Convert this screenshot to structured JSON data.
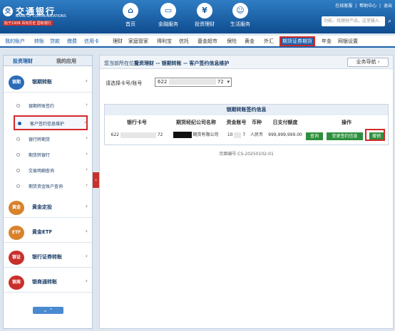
{
  "header": {
    "logo_glyph": "交",
    "bank_name_cn": "交通银行",
    "bank_name_en": "BANK OF COMMUNICATIONS",
    "since": "始于1908 百年历史 国有银行",
    "nav": [
      {
        "label": "首页",
        "icon": "home-icon",
        "glyph": "⌂"
      },
      {
        "label": "金融服务",
        "icon": "card-icon",
        "glyph": "▭"
      },
      {
        "label": "投资理财",
        "icon": "chart-icon",
        "glyph": "¥"
      },
      {
        "label": "生活服务",
        "icon": "life-icon",
        "glyph": "☺"
      }
    ],
    "top_links": [
      "在线客服",
      "|",
      "帮助中心",
      "|",
      "退出"
    ],
    "search_placeholder": "功能、找理财产品，这里输入",
    "search_glyph": "⌕"
  },
  "menubar": {
    "items": [
      "我的账户",
      "转账",
      "贷款",
      "缴费",
      "信用卡",
      "理财",
      "家庭管家",
      "得利宝",
      "信托",
      "基金超市",
      "保险",
      "黄金",
      "外汇",
      "期货证券期货",
      "年金",
      "网银设置"
    ]
  },
  "sidebar": {
    "tabs": [
      "投资理财",
      "我的应用"
    ],
    "sections": [
      {
        "icon_label": "银期",
        "label": "银期转账",
        "arrow": "›"
      },
      {
        "icon_label": "黄金",
        "label": "黄金定投",
        "arrow": "›"
      },
      {
        "icon_label": "ETF",
        "label": "黄金ETF",
        "arrow": "›"
      },
      {
        "icon_label": "银证",
        "label": "银行证券转账",
        "arrow": "›"
      },
      {
        "icon_label": "银商",
        "label": "银商通转账",
        "arrow": "›"
      }
    ],
    "subitems": [
      {
        "label": "银期转账签约",
        "arrow": "›"
      },
      {
        "label": "客户签约信息维护",
        "arrow": "›"
      },
      {
        "label": "银行转期货",
        "arrow": "›"
      },
      {
        "label": "期货转银行",
        "arrow": "›"
      },
      {
        "label": "交易明细查询",
        "arrow": "›"
      },
      {
        "label": "期货资金账户查询",
        "arrow": "›"
      }
    ],
    "expand_glyph": "⌄   ⌃",
    "collapse_glyph": "‹"
  },
  "content": {
    "breadcrumb_label": "您当前所在位置:",
    "breadcrumb": "投资理财 -- 银期转账 -- 客户签约信息维护",
    "biz_guide": "业务导航 ›",
    "account_label": "请选择卡号/账号",
    "account_prefix": "622",
    "account_suffix": "72",
    "account_chevron": "▾",
    "panel_title": "银期转账签约信息",
    "table": {
      "headers": [
        "银行卡号",
        "期货经纪公司名称",
        "资金账号",
        "币种",
        "日支付额度",
        "操作"
      ],
      "row": {
        "card_prefix": "622",
        "card_suffix": "72",
        "company": "期货有限公司",
        "fund_prefix": "10",
        "fund_suffix": "7",
        "currency": "人民币",
        "limit": "999,999,999.00"
      },
      "actions": [
        "查询",
        "变更签约信息",
        "撤销"
      ]
    },
    "page_id": "页面编号:CS-20250102-01"
  }
}
